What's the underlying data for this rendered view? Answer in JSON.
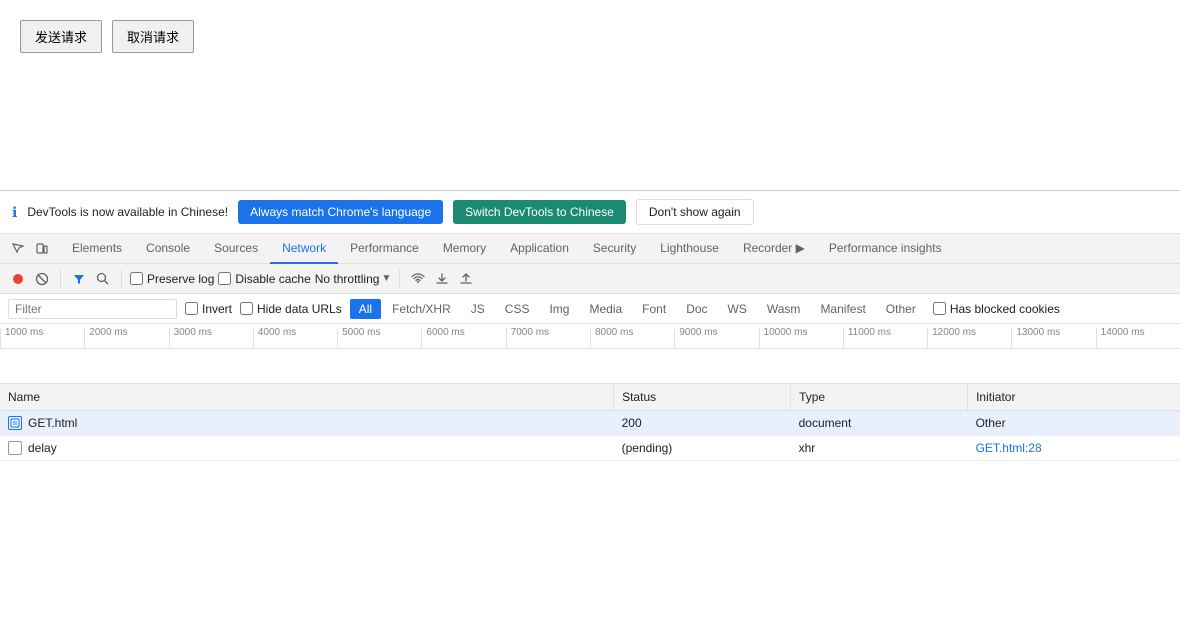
{
  "page": {
    "btn_send": "发送请求",
    "btn_cancel": "取消请求"
  },
  "banner": {
    "info_text": "DevTools is now available in Chinese!",
    "btn_always_match": "Always match Chrome's language",
    "btn_switch": "Switch DevTools to Chinese",
    "btn_dont_show": "Don't show again"
  },
  "tabs": [
    {
      "label": "Elements",
      "active": false
    },
    {
      "label": "Console",
      "active": false
    },
    {
      "label": "Sources",
      "active": false
    },
    {
      "label": "Network",
      "active": true
    },
    {
      "label": "Performance",
      "active": false
    },
    {
      "label": "Memory",
      "active": false
    },
    {
      "label": "Application",
      "active": false
    },
    {
      "label": "Security",
      "active": false
    },
    {
      "label": "Lighthouse",
      "active": false
    },
    {
      "label": "Recorder ▶",
      "active": false
    },
    {
      "label": "Performance insights",
      "active": false
    }
  ],
  "toolbar": {
    "preserve_log": "Preserve log",
    "disable_cache": "Disable cache",
    "no_throttling": "No throttling"
  },
  "filter": {
    "placeholder": "Filter",
    "invert": "Invert",
    "hide_data_urls": "Hide data URLs",
    "types": [
      "All",
      "Fetch/XHR",
      "JS",
      "CSS",
      "Img",
      "Media",
      "Font",
      "Doc",
      "WS",
      "Wasm",
      "Manifest",
      "Other"
    ],
    "has_blocked": "Has blocked cookies",
    "active_type": "All"
  },
  "timeline": {
    "ticks": [
      "1000 ms",
      "2000 ms",
      "3000 ms",
      "4000 ms",
      "5000 ms",
      "6000 ms",
      "7000 ms",
      "8000 ms",
      "9000 ms",
      "10000 ms",
      "11000 ms",
      "12000 ms",
      "13000 ms",
      "14000 ms"
    ]
  },
  "table": {
    "headers": [
      "Name",
      "Status",
      "Type",
      "Initiator"
    ],
    "rows": [
      {
        "name": "GET.html",
        "type_icon": "document",
        "status": "200",
        "type": "document",
        "initiator": "Other",
        "initiator_link": false,
        "selected": true
      },
      {
        "name": "delay",
        "type_icon": "xhr",
        "status": "(pending)",
        "type": "xhr",
        "initiator": "GET.html:28",
        "initiator_link": true,
        "selected": false
      }
    ]
  }
}
